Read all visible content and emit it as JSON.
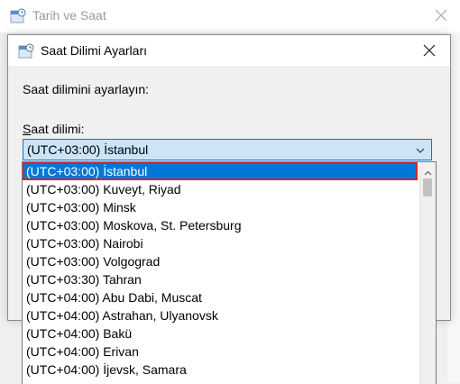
{
  "parent_window": {
    "title": "Tarih ve Saat",
    "close_icon": "close-icon"
  },
  "dialog": {
    "title": "Saat Dilimi Ayarları",
    "close_icon": "close-icon",
    "instruction": "Saat dilimini ayarlayın:",
    "timezone_label_underlined": "S",
    "timezone_label_rest": "aat dilimi:",
    "timezone_value": "(UTC+03:00) İstanbul"
  },
  "dropdown": {
    "items": [
      "(UTC+03:00) İstanbul",
      "(UTC+03:00) Kuveyt, Riyad",
      "(UTC+03:00) Minsk",
      "(UTC+03:00) Moskova, St. Petersburg",
      "(UTC+03:00) Nairobi",
      "(UTC+03:00) Volgograd",
      "(UTC+03:30) Tahran",
      "(UTC+04:00) Abu Dabi, Muscat",
      "(UTC+04:00) Astrahan, Ulyanovsk",
      "(UTC+04:00) Bakü",
      "(UTC+04:00) Erivan",
      "(UTC+04:00) İjevsk, Samara"
    ],
    "selected_index": 0
  },
  "colors": {
    "accent": "#0078d7",
    "selection_outline": "#cc2b2b",
    "combo_fill": "#cce4f7"
  }
}
